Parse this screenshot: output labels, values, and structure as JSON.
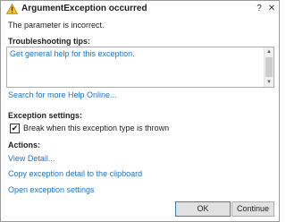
{
  "window": {
    "title": "ArgumentException occurred",
    "help_glyph": "?",
    "close_glyph": "✕"
  },
  "message": "The parameter is incorrect.",
  "troubleshooting": {
    "heading": "Troubleshooting tips:",
    "tips": [
      "Get general help for this exception."
    ]
  },
  "search_online_link": "Search for more Help Online...",
  "exception_settings": {
    "heading": "Exception settings:",
    "break_checkbox_label": "Break when this exception type is thrown",
    "break_checked": true
  },
  "actions": {
    "heading": "Actions:",
    "items": [
      "View Detail...",
      "Copy exception detail to the clipboard",
      "Open exception settings"
    ]
  },
  "buttons": {
    "ok": "OK",
    "continue": "Continue"
  },
  "colors": {
    "link": "#1e73c8",
    "warning_icon": "#f2c037"
  }
}
